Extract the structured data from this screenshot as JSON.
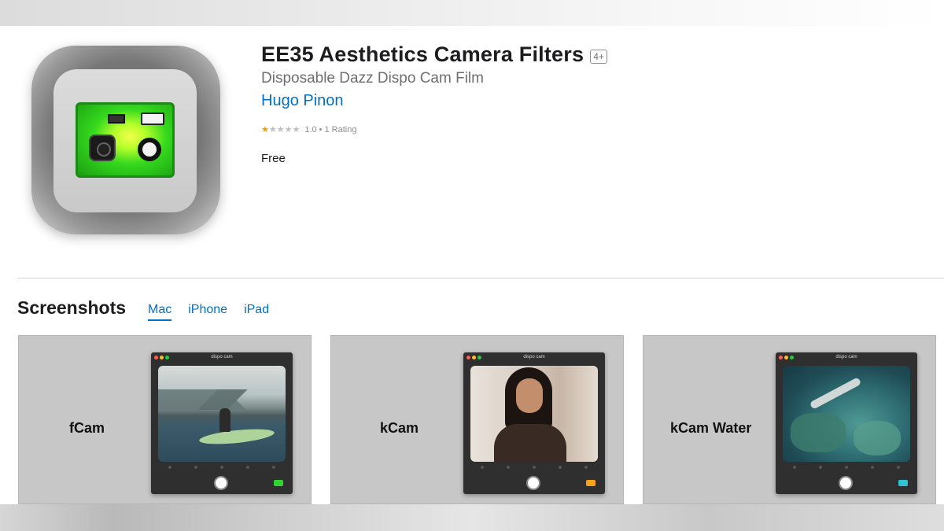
{
  "app": {
    "title": "EE35 Aesthetics Camera Filters",
    "age_rating": "4+",
    "subtitle": "Disposable Dazz Dispo Cam Film",
    "developer": "Hugo Pinon",
    "rating": {
      "stars_filled": 1,
      "stars_total": 5,
      "value": "1.0",
      "separator": "•",
      "count_label": "1 Rating"
    },
    "price": "Free",
    "icon": "disposable-camera-icon"
  },
  "screenshots": {
    "title": "Screenshots",
    "tabs": [
      {
        "label": "Mac",
        "active": true
      },
      {
        "label": "iPhone",
        "active": false
      },
      {
        "label": "iPad",
        "active": false
      }
    ],
    "cards": [
      {
        "label": "fCam",
        "window_title": "dispo cam",
        "photo": "lake-kayak-photo",
        "accent": "#2fd62f"
      },
      {
        "label": "kCam",
        "window_title": "dispo cam",
        "photo": "portrait-photo",
        "accent": "#f2a21b"
      },
      {
        "label": "kCam Water",
        "window_title": "dispo cam",
        "photo": "underwater-photo",
        "accent": "#2fc3d6"
      }
    ]
  },
  "colors": {
    "link": "#0070c9",
    "star": "#ff9500",
    "card_bg": "#c7c7c7"
  }
}
